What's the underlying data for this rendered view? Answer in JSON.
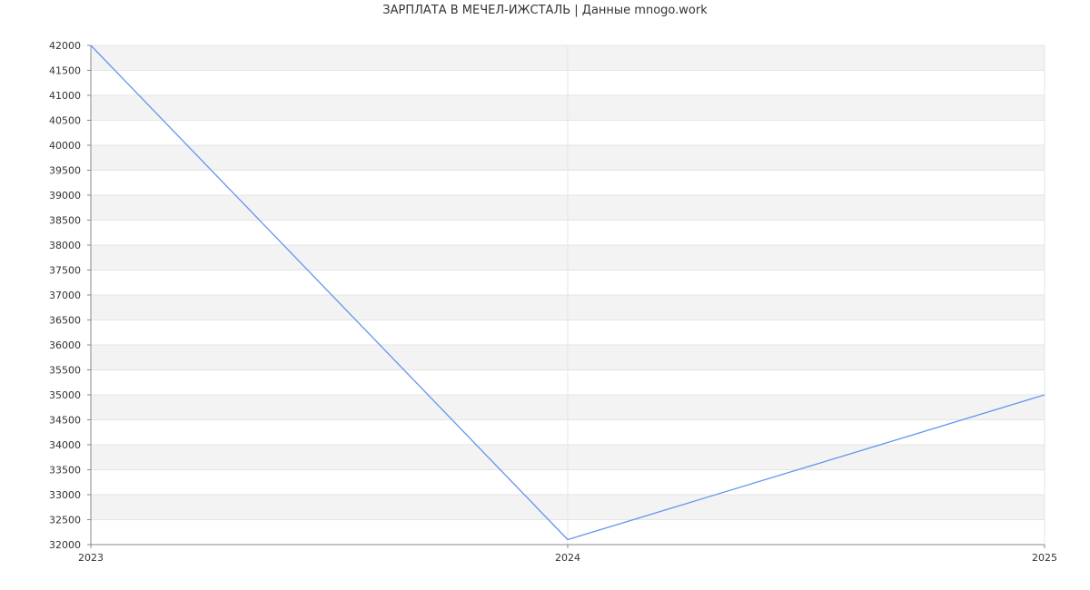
{
  "chart_data": {
    "type": "line",
    "title": "ЗАРПЛАТА В МЕЧЕЛ-ИЖСТАЛЬ | Данные mnogo.work",
    "xlabel": "",
    "ylabel": "",
    "x": [
      "2023",
      "2024",
      "2025"
    ],
    "series": [
      {
        "values": [
          42000,
          32100,
          35000
        ],
        "color": "#6495ed"
      }
    ],
    "ylim": [
      32000,
      42000
    ],
    "ytick_step": 500,
    "grid": true,
    "band_colors": [
      "#f3f3f3",
      "#ffffff"
    ],
    "axis_color": "#888888",
    "grid_color": "#e4e4e4"
  }
}
